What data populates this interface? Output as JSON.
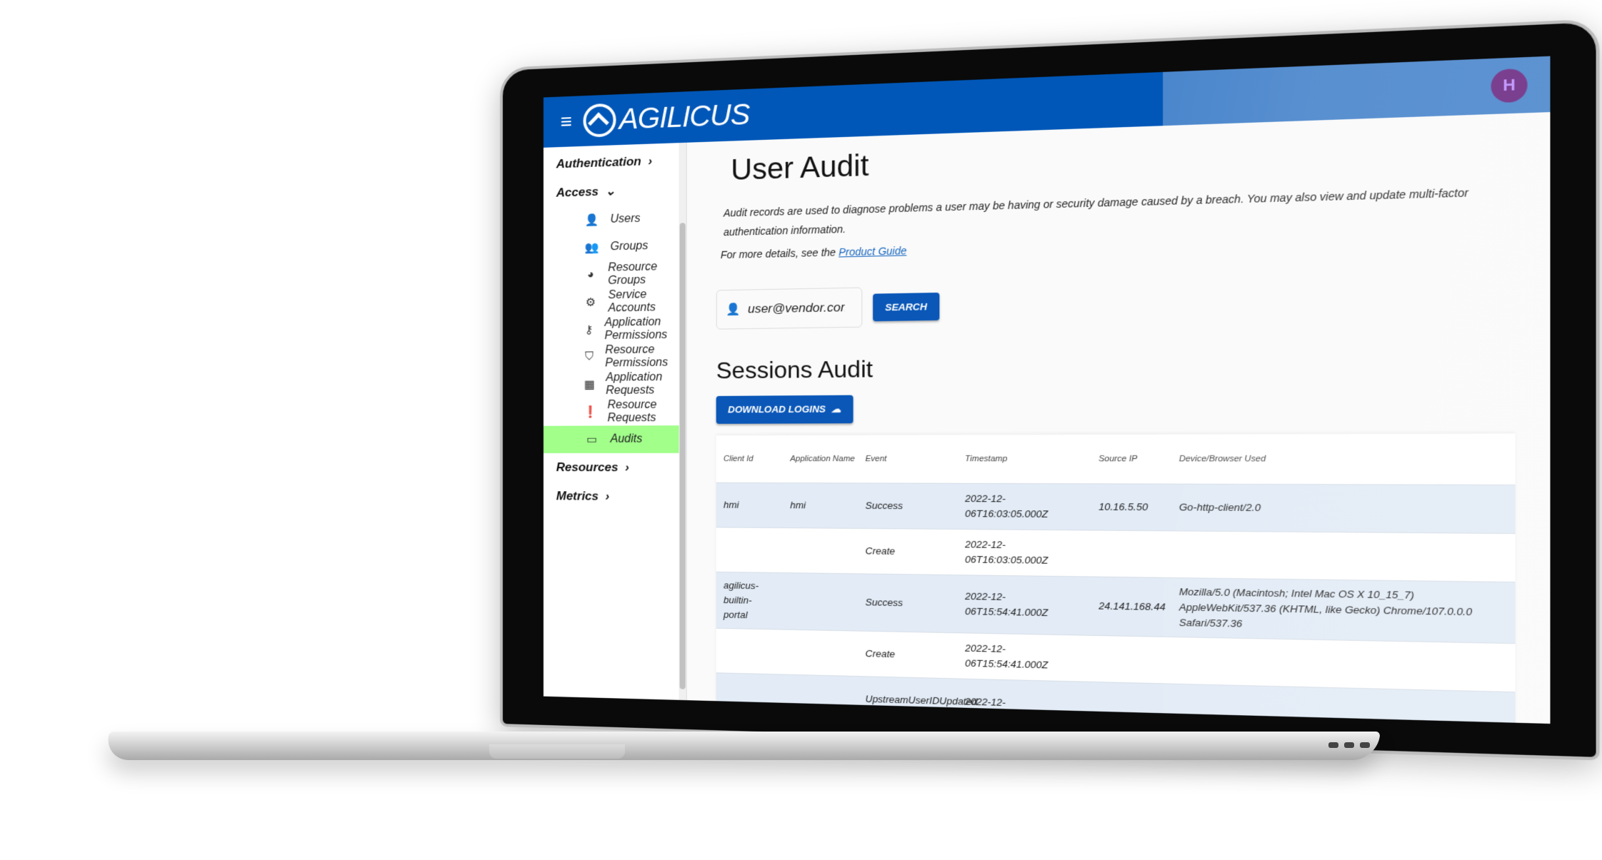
{
  "header": {
    "brand": "AGILICUS",
    "menu_icon": "menu-icon",
    "avatar_initials": "H",
    "colors": {
      "topbar": "#0057b8",
      "active_nav": "#a1ff8a",
      "button": "#0a57b8",
      "row_alt": "#e2ebf6"
    }
  },
  "sidebar": {
    "sections": [
      {
        "label": "Authentication",
        "chevron": "›"
      },
      {
        "label": "Access",
        "chevron": "⌄"
      }
    ],
    "items": [
      {
        "label": "Users",
        "icon": "user-icon"
      },
      {
        "label": "Groups",
        "icon": "groups-icon"
      },
      {
        "label": "Resource Groups",
        "icon": "resource-groups-icon"
      },
      {
        "label": "Service Accounts",
        "icon": "gears-icon"
      },
      {
        "label": "Application Permissions",
        "icon": "key-icon"
      },
      {
        "label": "Resource Permissions",
        "icon": "shield-check-icon"
      },
      {
        "label": "Application Requests",
        "icon": "grid-icon"
      },
      {
        "label": "Resource Requests",
        "icon": "clipboard-alert-icon"
      },
      {
        "label": "Audits",
        "icon": "briefcase-icon",
        "active": true
      }
    ],
    "bottom_sections": [
      {
        "label": "Resources",
        "chevron": "›"
      },
      {
        "label": "Metrics",
        "chevron": "›"
      }
    ]
  },
  "main": {
    "title": "User Audit",
    "description": "Audit records are used to diagnose problems a user may be having or security damage caused by a breach. You may also view and update multi-factor authentication information.",
    "more_prefix": "For more details, see the",
    "more_link": "Product Guide",
    "search": {
      "value": "user@vendor.com",
      "button": "SEARCH"
    },
    "sessions_title": "Sessions Audit",
    "download_button": "DOWNLOAD LOGINS",
    "table": {
      "columns": [
        "Client Id",
        "Application Name",
        "Event",
        "Timestamp",
        "Source IP",
        "Device/Browser Used"
      ],
      "rows": [
        {
          "client_id": "hmi",
          "app_name": "hmi",
          "event": "Success",
          "timestamp": "2022-12-06T16:03:05.000Z",
          "source_ip": "10.16.5.50",
          "device": "Go-http-client/2.0"
        },
        {
          "client_id": "",
          "app_name": "",
          "event": "Create",
          "timestamp": "2022-12-06T16:03:05.000Z",
          "source_ip": "",
          "device": ""
        },
        {
          "client_id": "agilicus-builtin-portal",
          "app_name": "",
          "event": "Success",
          "timestamp": "2022-12-06T15:54:41.000Z",
          "source_ip": "24.141.168.44",
          "device": "Mozilla/5.0 (Macintosh; Intel Mac OS X 10_15_7) AppleWebKit/537.36 (KHTML, like Gecko) Chrome/107.0.0.0 Safari/537.36"
        },
        {
          "client_id": "",
          "app_name": "",
          "event": "Create",
          "timestamp": "2022-12-06T15:54:41.000Z",
          "source_ip": "",
          "device": ""
        },
        {
          "client_id": "",
          "app_name": "",
          "event": "UpstreamUserIDUpdated",
          "timestamp": "2022-12-",
          "source_ip": "",
          "device": ""
        }
      ]
    }
  }
}
